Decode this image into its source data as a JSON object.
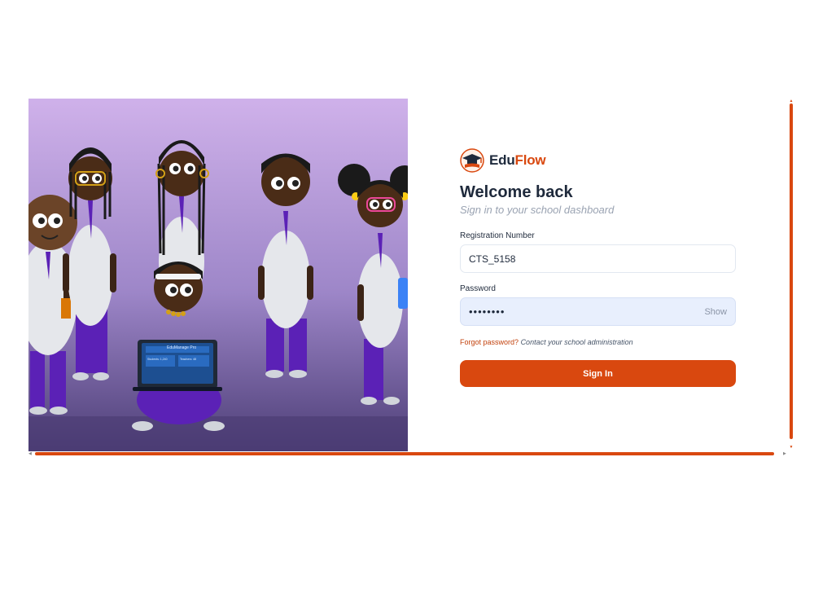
{
  "brand": {
    "name_part1": "Edu",
    "name_part2": "Flow"
  },
  "login": {
    "title": "Welcome back",
    "subtitle": "Sign in to your school dashboard",
    "reg_label": "Registration Number",
    "reg_value": "CTS_5158",
    "password_label": "Password",
    "password_value": "••••••••",
    "show_label": "Show",
    "forgot_link": "Forgot password?",
    "forgot_hint": "Contact your school administration",
    "signin_label": "Sign In"
  },
  "illustration": {
    "laptop_title": "EduManage Pro",
    "laptop_stat1": "Students: 1,240",
    "laptop_stat2": "Teachers: 48"
  },
  "colors": {
    "accent": "#d9480f",
    "dark": "#1e293b",
    "purple": "#5b21b6",
    "bg_lavender": "#c9aee6"
  }
}
